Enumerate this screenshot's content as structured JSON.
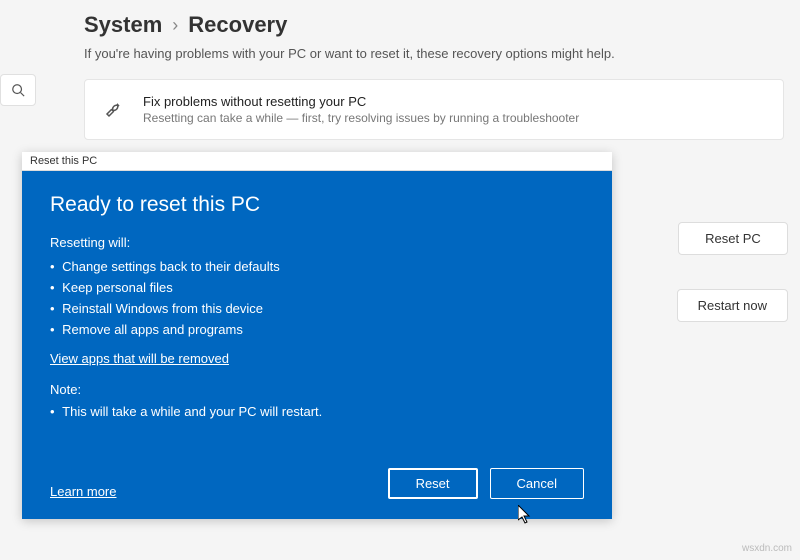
{
  "breadcrumb": {
    "parent": "System",
    "current": "Recovery"
  },
  "subtitle": "If you're having problems with your PC or want to reset it, these recovery options might help.",
  "troubleshoot_card": {
    "title": "Fix problems without resetting your PC",
    "sub": "Resetting can take a while — first, try resolving issues by running a troubleshooter"
  },
  "side": {
    "reset": "Reset PC",
    "restart": "Restart now"
  },
  "dialog": {
    "window_title": "Reset this PC",
    "heading": "Ready to reset this PC",
    "resetting_label": "Resetting will:",
    "items": [
      "Change settings back to their defaults",
      "Keep personal files",
      "Reinstall Windows from this device",
      "Remove all apps and programs"
    ],
    "view_apps": "View apps that will be removed",
    "note_label": "Note:",
    "note_items": [
      "This will take a while and your PC will restart."
    ],
    "learn_more": "Learn more",
    "reset_btn": "Reset",
    "cancel_btn": "Cancel"
  },
  "watermark": "wsxdn.com"
}
